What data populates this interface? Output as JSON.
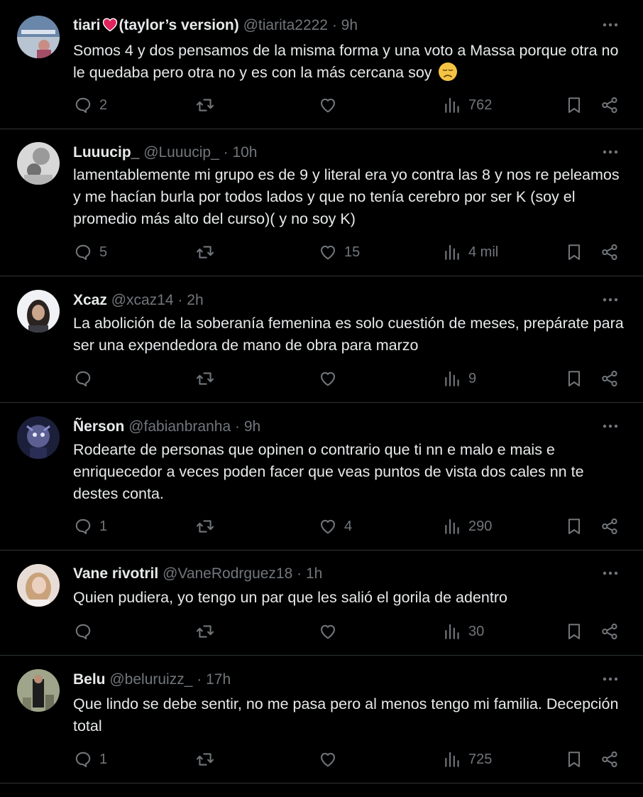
{
  "colors": {
    "background": "#000000",
    "text": "#e7e9ea",
    "secondary": "#71767b",
    "divider": "#2f3336",
    "heart_emoji": "#e0245e"
  },
  "icons": {
    "reply": "reply-icon",
    "retweet": "retweet-icon",
    "like": "heart-icon",
    "views": "views-bar-icon",
    "bookmark": "bookmark-icon",
    "share": "share-icon",
    "more": "more-dots-icon"
  },
  "tweets": [
    {
      "name_before": "tiari",
      "name_after": "(taylor’s version)",
      "handle": "@tiarita2222",
      "sep": "·",
      "time": "9h",
      "text": "Somos 4 y dos pensamos de la misma forma y una voto a Massa porque otra no le quedaba pero otra no y es con la más cercana soy",
      "replies": "2",
      "retweets": "",
      "likes": "",
      "views": "762"
    },
    {
      "name": "Luuucip_",
      "handle": "@Luuucip_",
      "sep": "·",
      "time": "10h",
      "text": "lamentablemente mi grupo es de 9 y literal era yo contra las 8 y nos re peleamos y me hacían burla por todos lados y que no tenía cerebro por ser K (soy el promedio más alto del curso)( y no soy K)",
      "replies": "5",
      "retweets": "",
      "likes": "15",
      "views": "4 mil"
    },
    {
      "name": "Xcaz",
      "handle": "@xcaz14",
      "sep": "·",
      "time": "2h",
      "text": "La abolición de la soberanía femenina es solo cuestión de meses, prepárate para ser una expendedora de mano de obra para marzo",
      "replies": "",
      "retweets": "",
      "likes": "",
      "views": "9"
    },
    {
      "name": "Ñerson",
      "handle": "@fabianbranha",
      "sep": "·",
      "time": "9h",
      "text": "Rodearte de personas que opinen o contrario que ti nn e malo e mais e enriquecedor a veces poden facer que veas puntos de vista dos cales nn te destes conta.",
      "replies": "1",
      "retweets": "",
      "likes": "4",
      "views": "290"
    },
    {
      "name": "Vane rivotril",
      "handle": "@VaneRodrguez18",
      "sep": "·",
      "time": "1h",
      "text": "Quien pudiera, yo tengo un par que les salió el gorila de adentro",
      "replies": "",
      "retweets": "",
      "likes": "",
      "views": "30"
    },
    {
      "name": "Belu",
      "handle": "@beluruizz_",
      "sep": "·",
      "time": "17h",
      "text": "Que lindo se debe sentir, no me pasa pero al menos tengo mi familia. Decepción total",
      "replies": "1",
      "retweets": "",
      "likes": "",
      "views": "725"
    }
  ]
}
